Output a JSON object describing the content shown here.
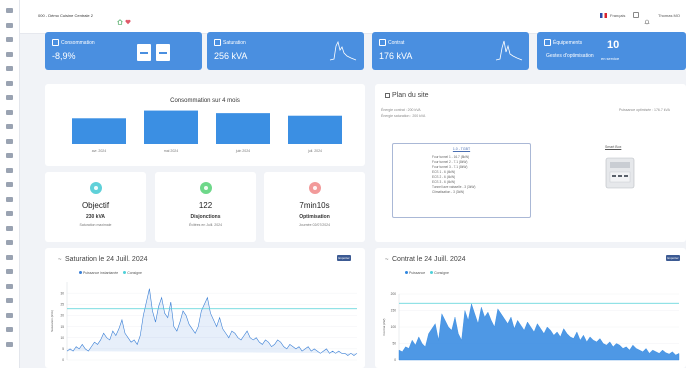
{
  "topbar": {
    "site": "000 - Démo Cuisine Centrale 2",
    "language": "Français",
    "user": "Thomas MO"
  },
  "kpis": {
    "consommation": {
      "title": "Consommation",
      "value": "-8,9%"
    },
    "saturation": {
      "title": "Saturation",
      "value": "256 kVA"
    },
    "contrat": {
      "title": "Contrat",
      "value": "176 kVA"
    },
    "equipements": {
      "title": "Équipements",
      "subtitle": "Gestes d'optimisation",
      "count": "10",
      "count_label": "en service"
    }
  },
  "consumption": {
    "title": "Consommation sur 4 mois",
    "chart_data": {
      "type": "bar",
      "categories": [
        "avr. 2024",
        "mai 2024",
        "juin 2024",
        "juil. 2024"
      ],
      "values": [
        20,
        26,
        24,
        22
      ],
      "color": "#3b8fe3"
    }
  },
  "stats": [
    {
      "name": "objectif",
      "big": "Objectif",
      "mid": "230 kVA",
      "small": "Saturation maximale",
      "color": "#5fd1d9"
    },
    {
      "name": "disjonctions",
      "big": "122",
      "mid": "Disjonctions",
      "small": "Évitées en Juill. 2024",
      "color": "#6ed88a"
    },
    {
      "name": "optimisation",
      "big": "7min10s",
      "mid": "Optimisation",
      "small": "Journée 02/07/2024",
      "color": "#f29a9a"
    }
  ],
  "plan": {
    "title": "Plan du site",
    "left_lines": [
      "Énergie contrat : 200 kVA",
      "Énergie saturation : 200 kVA"
    ],
    "right_line": "Puissance optimisée : 176.7 kVA",
    "box_title": "1.0 - TGBT",
    "box_items": [
      "Four tunnel 1 - 16.7 (8kW)",
      "Four tunnel 2 - 7.1 (8kW)",
      "Four tunnel 3 - 7.1 (8kW)",
      "ECS 1 - 6 (4kW)",
      "ECS 2 - 6 (4kW)",
      "ECS 3 - 6 (4kW)",
      "Tunnel lave vaisselle - 3 (3kW)",
      "Climatisation - 3 (3kW)"
    ],
    "device_label": "Smart Box"
  },
  "saturation_chart": {
    "title": "Saturation le 24 Juill. 2024",
    "button": "Exporter",
    "chart_data": {
      "type": "line",
      "series": [
        {
          "name": "Puissance instantanée",
          "color": "#3a7fd5"
        },
        {
          "name": "Consigne",
          "color": "#4fd0d8",
          "value": 23
        }
      ],
      "ylabel": "Saturation (kVA)",
      "yticks": [
        "30",
        "25",
        "20",
        "15",
        "10",
        "5",
        "0"
      ],
      "ylim": [
        0,
        35
      ],
      "values": [
        4,
        5,
        4,
        6,
        5,
        7,
        5,
        4,
        6,
        8,
        7,
        9,
        12,
        10,
        9,
        13,
        11,
        14,
        18,
        12,
        10,
        8,
        9,
        7,
        11,
        20,
        26,
        32,
        22,
        17,
        24,
        28,
        21,
        19,
        26,
        15,
        13,
        17,
        22,
        20,
        16,
        14,
        12,
        15,
        22,
        25,
        28,
        21,
        18,
        15,
        19,
        14,
        12,
        10,
        13,
        12,
        10,
        9,
        11,
        13,
        10,
        9,
        10,
        8,
        7,
        9,
        8,
        6,
        7,
        9,
        8,
        6,
        5,
        7,
        6,
        5,
        6,
        4,
        5,
        6,
        4,
        5,
        4,
        3,
        4,
        5,
        3,
        4,
        3,
        4,
        3,
        3,
        2,
        3,
        2,
        3
      ]
    }
  },
  "contrat_chart": {
    "title": "Contrat le 24 Juill. 2024",
    "button": "Exporter",
    "chart_data": {
      "type": "area",
      "series": [
        {
          "name": "Puissance",
          "color": "#2f86e0"
        },
        {
          "name": "Consigne",
          "color": "#4fd0d8",
          "value": 172
        }
      ],
      "ylabel": "Contrat (kW)",
      "yticks": [
        "200",
        "150",
        "100",
        "50",
        "0"
      ],
      "ylim": [
        0,
        200
      ],
      "values": [
        30,
        25,
        40,
        35,
        60,
        45,
        70,
        50,
        40,
        80,
        95,
        110,
        60,
        140,
        120,
        100,
        90,
        130,
        80,
        60,
        150,
        120,
        170,
        140,
        110,
        160,
        130,
        145,
        120,
        100,
        155,
        140,
        125,
        110,
        130,
        95,
        120,
        105,
        90,
        115,
        100,
        85,
        110,
        95,
        80,
        100,
        90,
        75,
        85,
        70,
        95,
        80,
        70,
        65,
        85,
        60,
        75,
        55,
        70,
        60,
        55,
        65,
        50,
        45,
        55,
        40,
        50,
        45,
        35,
        40,
        30,
        45,
        35,
        30,
        25,
        35,
        20,
        30,
        25,
        20,
        30,
        22,
        18,
        25,
        15,
        20
      ]
    }
  }
}
